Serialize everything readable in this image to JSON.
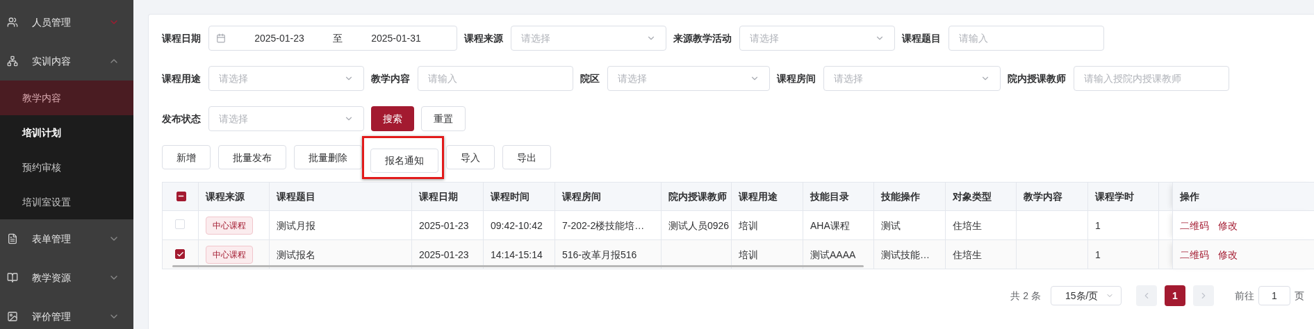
{
  "sidebar": {
    "items": [
      {
        "label": "人员管理",
        "expanded": false,
        "highlighted": true
      },
      {
        "label": "实训内容",
        "expanded": true,
        "highlighted": false,
        "children": [
          {
            "label": "教学内容",
            "selected": true,
            "hovered": false
          },
          {
            "label": "培训计划",
            "selected": false,
            "hovered": true
          },
          {
            "label": "预约审核",
            "selected": false,
            "hovered": false
          },
          {
            "label": "培训室设置",
            "selected": false,
            "hovered": false
          }
        ]
      },
      {
        "label": "表单管理",
        "expanded": false,
        "highlighted": false
      },
      {
        "label": "教学资源",
        "expanded": false,
        "highlighted": false
      },
      {
        "label": "评价管理",
        "expanded": false,
        "highlighted": false
      }
    ]
  },
  "filters": [
    [
      {
        "label": "课程日期",
        "kind": "date_range",
        "start": "2025-01-23",
        "separator": "至",
        "end": "2025-01-31"
      },
      {
        "label": "课程来源",
        "kind": "select",
        "placeholder": "请选择"
      },
      {
        "label": "来源教学活动",
        "kind": "select",
        "placeholder": "请选择"
      },
      {
        "label": "课程题目",
        "kind": "input",
        "placeholder": "请输入"
      }
    ],
    [
      {
        "label": "课程用途",
        "kind": "select",
        "placeholder": "请选择"
      },
      {
        "label": "教学内容",
        "kind": "input",
        "placeholder": "请输入"
      },
      {
        "label": "院区",
        "kind": "select",
        "placeholder": "请选择"
      },
      {
        "label": "课程房间",
        "kind": "select",
        "placeholder": "请选择"
      },
      {
        "label": "院内授课教师",
        "kind": "input",
        "placeholder": "请输入授院内授课教师"
      }
    ],
    [
      {
        "label": "发布状态",
        "kind": "select",
        "placeholder": "请选择"
      }
    ]
  ],
  "filter_actions": [
    {
      "label": "搜索",
      "primary": true
    },
    {
      "label": "重置",
      "primary": false
    }
  ],
  "toolbar": [
    {
      "label": "新增",
      "highlighted": false
    },
    {
      "label": "批量发布",
      "highlighted": false
    },
    {
      "label": "批量删除",
      "highlighted": false
    },
    {
      "label": "报名通知",
      "highlighted": true
    },
    {
      "label": "导入",
      "highlighted": false
    },
    {
      "label": "导出",
      "highlighted": false
    }
  ],
  "table": {
    "select_all": {
      "indeterminate": true
    },
    "columns": [
      "课程来源",
      "课程题目",
      "课程日期",
      "课程时间",
      "课程房间",
      "院内授课教师",
      "课程用途",
      "技能目录",
      "技能操作",
      "对象类型",
      "教学内容",
      "课程学时"
    ],
    "action_column": "操作",
    "rows": [
      {
        "checked": false,
        "cells": [
          "中心课程",
          "测试月报",
          "2025-01-23",
          "09:42-10:42",
          "7-202-2楼技能培…",
          "测试人员0926",
          "培训",
          "AHA课程",
          "测试",
          "住培生",
          null,
          "1"
        ],
        "actions": [
          "二维码",
          "修改"
        ]
      },
      {
        "checked": true,
        "cells": [
          "中心课程",
          "测试报名",
          "2025-01-23",
          "14:14-15:14",
          "516-改革月报516",
          null,
          "培训",
          "测试AAAA",
          "测试技能…",
          "住培生",
          null,
          "1"
        ],
        "actions": [
          "二维码",
          "修改"
        ]
      }
    ]
  },
  "pagination": {
    "total": "共 2 条",
    "page_size": "15条/页",
    "prev_disabled": true,
    "next_disabled": true,
    "pages": [
      {
        "label": "1",
        "selected": true
      }
    ],
    "goto_label": "前往",
    "goto_value": "1",
    "goto_suffix": "页"
  }
}
